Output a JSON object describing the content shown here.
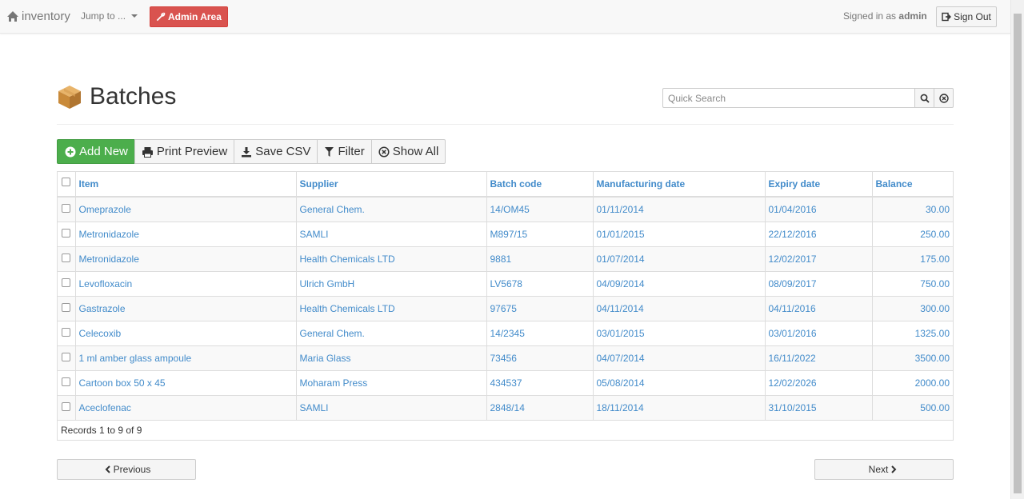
{
  "navbar": {
    "brand": "inventory",
    "jump_label": "Jump to ...",
    "admin_label": "Admin Area",
    "signed_prefix": "Signed in as",
    "signed_user": "admin",
    "signout_label": "Sign Out"
  },
  "page": {
    "title": "Batches",
    "search_placeholder": "Quick Search"
  },
  "toolbar": {
    "add_new": "Add New",
    "print_preview": "Print Preview",
    "save_csv": "Save CSV",
    "filter": "Filter",
    "show_all": "Show All"
  },
  "table": {
    "columns": [
      "Item",
      "Supplier",
      "Batch code",
      "Manufacturing date",
      "Expiry date",
      "Balance"
    ],
    "rows": [
      [
        "Omeprazole",
        "General Chem.",
        "14/OM45",
        "01/11/2014",
        "01/04/2016",
        "30.00"
      ],
      [
        "Metronidazole",
        "SAMLI",
        "M897/15",
        "01/01/2015",
        "22/12/2016",
        "250.00"
      ],
      [
        "Metronidazole",
        "Health Chemicals LTD",
        "9881",
        "01/07/2014",
        "12/02/2017",
        "175.00"
      ],
      [
        "Levofloxacin",
        "Ulrich GmbH",
        "LV5678",
        "04/09/2014",
        "08/09/2017",
        "750.00"
      ],
      [
        "Gastrazole",
        "Health Chemicals LTD",
        "97675",
        "04/11/2014",
        "04/11/2016",
        "300.00"
      ],
      [
        "Celecoxib",
        "General Chem.",
        "14/2345",
        "03/01/2015",
        "03/01/2016",
        "1325.00"
      ],
      [
        "1 ml amber glass ampoule",
        "Maria Glass",
        "73456",
        "04/07/2014",
        "16/11/2022",
        "3500.00"
      ],
      [
        "Cartoon box 50 x 45",
        "Moharam Press",
        "434537",
        "05/08/2014",
        "12/02/2026",
        "2000.00"
      ],
      [
        "Aceclofenac",
        "SAMLI",
        "2848/14",
        "18/11/2014",
        "31/10/2015",
        "500.00"
      ]
    ],
    "records_text": "Records 1 to 9 of 9"
  },
  "pager": {
    "previous": "Previous",
    "next": "Next"
  }
}
